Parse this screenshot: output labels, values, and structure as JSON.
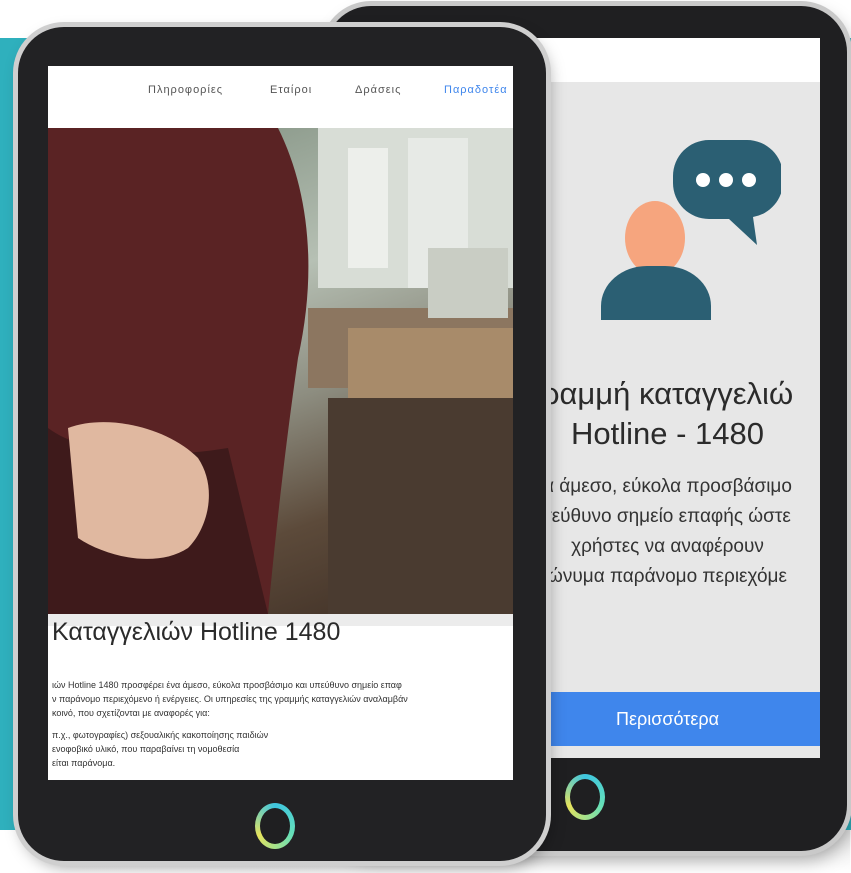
{
  "front_screen": {
    "nav": [
      "Πληροφορίες",
      "Εταίροι",
      "Δράσεις",
      "Παραδοτέα"
    ],
    "nav_active_index": 3,
    "heading": "Καταγγελιών Hotline 1480",
    "paragraph_lines": [
      "ιών Hotline 1480 προσφέρει ένα άμεσο, εύκολα προσβάσιμο και υπεύθυνο σημείο επαφ",
      "ν παράνομο περιεχόμενο ή ενέργειες. Οι υπηρεσίες της γραμμής καταγγελιών αναλαμβάν",
      "κοινό, που σχετίζονται με αναφορές για:"
    ],
    "list_lines": [
      "π.χ., φωτογραφίες) σεξουαλικής κακοποίησης παιδιών",
      "ενοφοβικό υλικό, που παραβαίνει τη νομοθεσία",
      "είται παράνομα."
    ]
  },
  "back_screen": {
    "title_lines": [
      "ραμμή καταγγελιώ",
      "Hotline - 1480"
    ],
    "text_lines": [
      "α άμεσο, εύκολα προσβάσιμο",
      "τεύθυνο σημείο επαφής ώστε",
      "χρήστες να αναφέρουν",
      "ώνυμα παράνομο περιεχόμε"
    ],
    "button_label": "Περισσότερα"
  },
  "colors": {
    "teal_background": "#2fb0bd",
    "accent_blue": "#3f86ec",
    "icon_bubble": "#2b5f73",
    "icon_person_head": "#f6a57e",
    "icon_person_body": "#2b5f73"
  },
  "icons": [
    "person-with-chat-bubble-icon",
    "home-button-ring-icon"
  ]
}
